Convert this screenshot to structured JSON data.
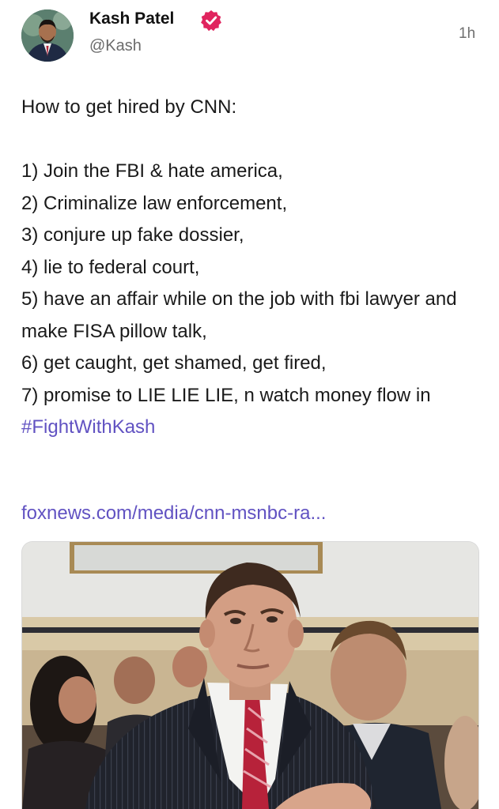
{
  "post": {
    "author": {
      "name": "Kash Patel",
      "handle": "@Kash",
      "verified": true
    },
    "timestamp": "1h",
    "intro": "How to get hired by CNN:",
    "steps": [
      "1) Join the FBI & hate america,",
      "2) Criminalize law enforcement,",
      "3) conjure up fake dossier,",
      "4) lie to federal court,",
      "5) have an affair while on the job with fbi lawyer and make FISA pillow talk,",
      "6) get caught, get shamed, get fired,",
      "7) promise to LIE LIE LIE, n watch money flow in"
    ],
    "hashtag": "#FightWithKash",
    "link_url": "foxnews.com/media/cnn-msnbc-ra...",
    "link_preview": {
      "image_icon": "photo-preview"
    }
  },
  "colors": {
    "link": "#6152c2",
    "verified_badge": "#e0245e",
    "handle": "#6b6b6b"
  }
}
